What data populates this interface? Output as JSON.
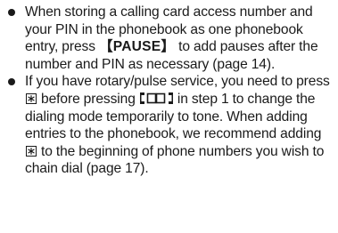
{
  "bullets": [
    {
      "before_key": "When storing a calling card access number and your PIN in the phonebook as one phonebook entry, press ",
      "key": "【PAUSE】",
      "after_key": " to add pauses after the number and PIN as necessary (page 14)."
    },
    {
      "part1": "If you have rotary/pulse service, you need to press ",
      "part2": " before pressing ",
      "part3": " in step 1 to change the dialing mode temporarily to tone. When adding entries to the phonebook, we recommend adding ",
      "part4": " to the beginning of phone numbers you wish to chain dial (page 17)."
    }
  ],
  "icons": {
    "star_key": "star-key-icon",
    "phonebook_key": "phonebook-key-icon"
  }
}
